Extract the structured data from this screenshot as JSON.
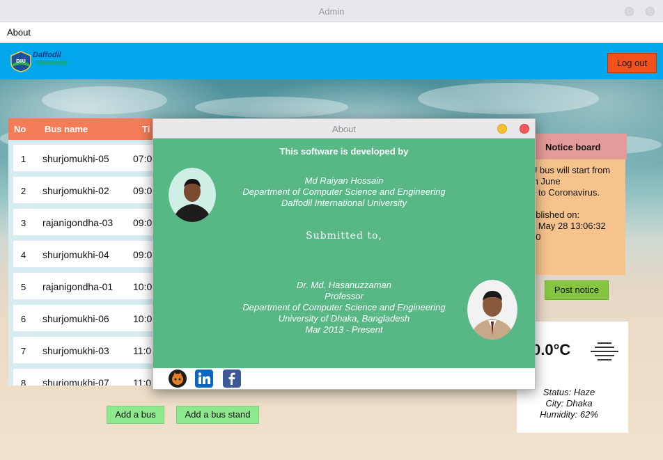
{
  "window": {
    "title": "Admin"
  },
  "menubar": {
    "items": [
      "About"
    ]
  },
  "header": {
    "logo_line1": "Daffodil",
    "logo_line2": "University",
    "logout_label": "Log out",
    "bg_color": "#02a6ea",
    "logout_color": "#f2511b"
  },
  "bus_table": {
    "columns": [
      "No",
      "Bus name",
      "Ti"
    ],
    "rows": [
      {
        "no": "1",
        "name": "shurjomukhi-05",
        "time": "07:0"
      },
      {
        "no": "2",
        "name": "shurjomukhi-02",
        "time": "09:0"
      },
      {
        "no": "3",
        "name": "rajanigondha-03",
        "time": "09:0"
      },
      {
        "no": "4",
        "name": "shurjomukhi-04",
        "time": "09:0"
      },
      {
        "no": "5",
        "name": "rajanigondha-01",
        "time": "10:0"
      },
      {
        "no": "6",
        "name": "shurjomukhi-06",
        "time": "10:0"
      },
      {
        "no": "7",
        "name": "shurjomukhi-03",
        "time": "11:0"
      },
      {
        "no": "8",
        "name": "shurjomukhi-07",
        "time": "11:0"
      }
    ],
    "header_color": "#f47d58"
  },
  "actions": {
    "add_bus_label": "Add a bus",
    "add_bus_stand_label": "Add a bus stand"
  },
  "notice_board": {
    "title": "Notice board",
    "lines": [
      "U bus will start from",
      "th June",
      "e to Coronavirus.",
      "",
      "ublished on:",
      "u May 28 13:06:32",
      "20"
    ],
    "post_label": "Post notice"
  },
  "weather": {
    "temperature": "0.0°C",
    "icon": "haze-icon",
    "status": "Status: Haze",
    "city": "City: Dhaka",
    "humidity": "Humidity: 62%"
  },
  "about_dialog": {
    "title": "About",
    "heading": "This software is developed by",
    "developer": {
      "name": "Md Raiyan Hossain",
      "department": "Department of Computer Science and Engineering",
      "university": "Daffodil International University"
    },
    "submitted_to_label": "Submitted to,",
    "supervisor": {
      "name": "Dr. Md. Hasanuzzaman",
      "title": "Professor",
      "department": "Department of Computer Science and Engineering",
      "university": "University of Dhaka, Bangladesh",
      "tenure": "Mar 2013 - Present"
    },
    "social_icons": [
      "github-icon",
      "linkedin-icon",
      "facebook-icon"
    ],
    "bg_color": "#57b785"
  }
}
